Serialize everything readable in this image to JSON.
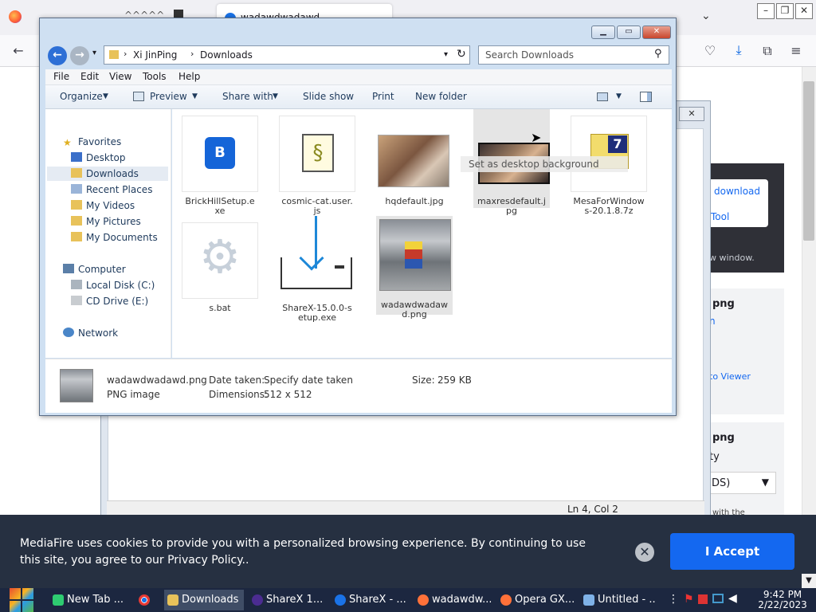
{
  "firefox": {
    "tab1_title": "^^^^^  ",
    "tab2_title": "wadawdwadawd"
  },
  "page_bg": {
    "download_link": "download",
    "tool_link": "Tool",
    "new_window": "w window.",
    "png1": "png",
    "png1_sub": "n",
    "viewer_link": "to Viewer",
    "png2": "png",
    "png2_sub": "ty",
    "select_value": "DS)",
    "with_the": "with the"
  },
  "notepad": {
    "status_position": "Ln 4, Col 2"
  },
  "explorer": {
    "breadcrumb": [
      "Xi JinPing",
      "Downloads"
    ],
    "search_placeholder": "Search Downloads",
    "menu": [
      "File",
      "Edit",
      "View",
      "Tools",
      "Help"
    ],
    "toolbar": [
      "Organize",
      "Preview",
      "Share with",
      "Slide show",
      "Print",
      "New folder"
    ],
    "nav": {
      "favorites": "Favorites",
      "desktop": "Desktop",
      "downloads": "Downloads",
      "recent": "Recent Places",
      "videos": "My Videos",
      "pictures": "My Pictures",
      "documents": "My Documents",
      "computer": "Computer",
      "local_disk": "Local Disk (C:)",
      "cd_drive": "CD Drive (E:)",
      "network": "Network"
    },
    "files": [
      {
        "name": "BrickHillSetup.exe"
      },
      {
        "name": "cosmic-cat.user.js"
      },
      {
        "name": "hqdefault.jpg"
      },
      {
        "name": "maxresdefault.jpg"
      },
      {
        "name": "MesaForWindows-20.1.8.7z"
      },
      {
        "name": "s.bat"
      },
      {
        "name": "ShareX-15.0.0-setup.exe"
      },
      {
        "name": "wadawdwadawd.png"
      }
    ],
    "tooltip": "Set as desktop background",
    "details": {
      "filename": "wadawdwadawd.png",
      "filetype": "PNG image",
      "date_label": "Date taken:",
      "date_value": "Specify date taken",
      "dim_label": "Dimensions:",
      "dim_value": "512 x 512",
      "size_label": "Size:",
      "size_value": "259 KB"
    }
  },
  "cookie": {
    "text": "MediaFire uses cookies to provide you with a personalized browsing experience. By continuing to use this site, you agree to our Privacy Policy..",
    "accept": "I Accept"
  },
  "taskbar": {
    "items": [
      "New Tab ...",
      "",
      "Downloads",
      "ShareX 1...",
      "ShareX - ...",
      "wadawdw...",
      "Opera GX...",
      "Untitled - ..."
    ],
    "time": "9:42 PM",
    "date": "2/22/2023"
  },
  "colors": {
    "accent": "#1468f0",
    "taskbar": "#1c2740",
    "cookie_bg": "#263041"
  }
}
